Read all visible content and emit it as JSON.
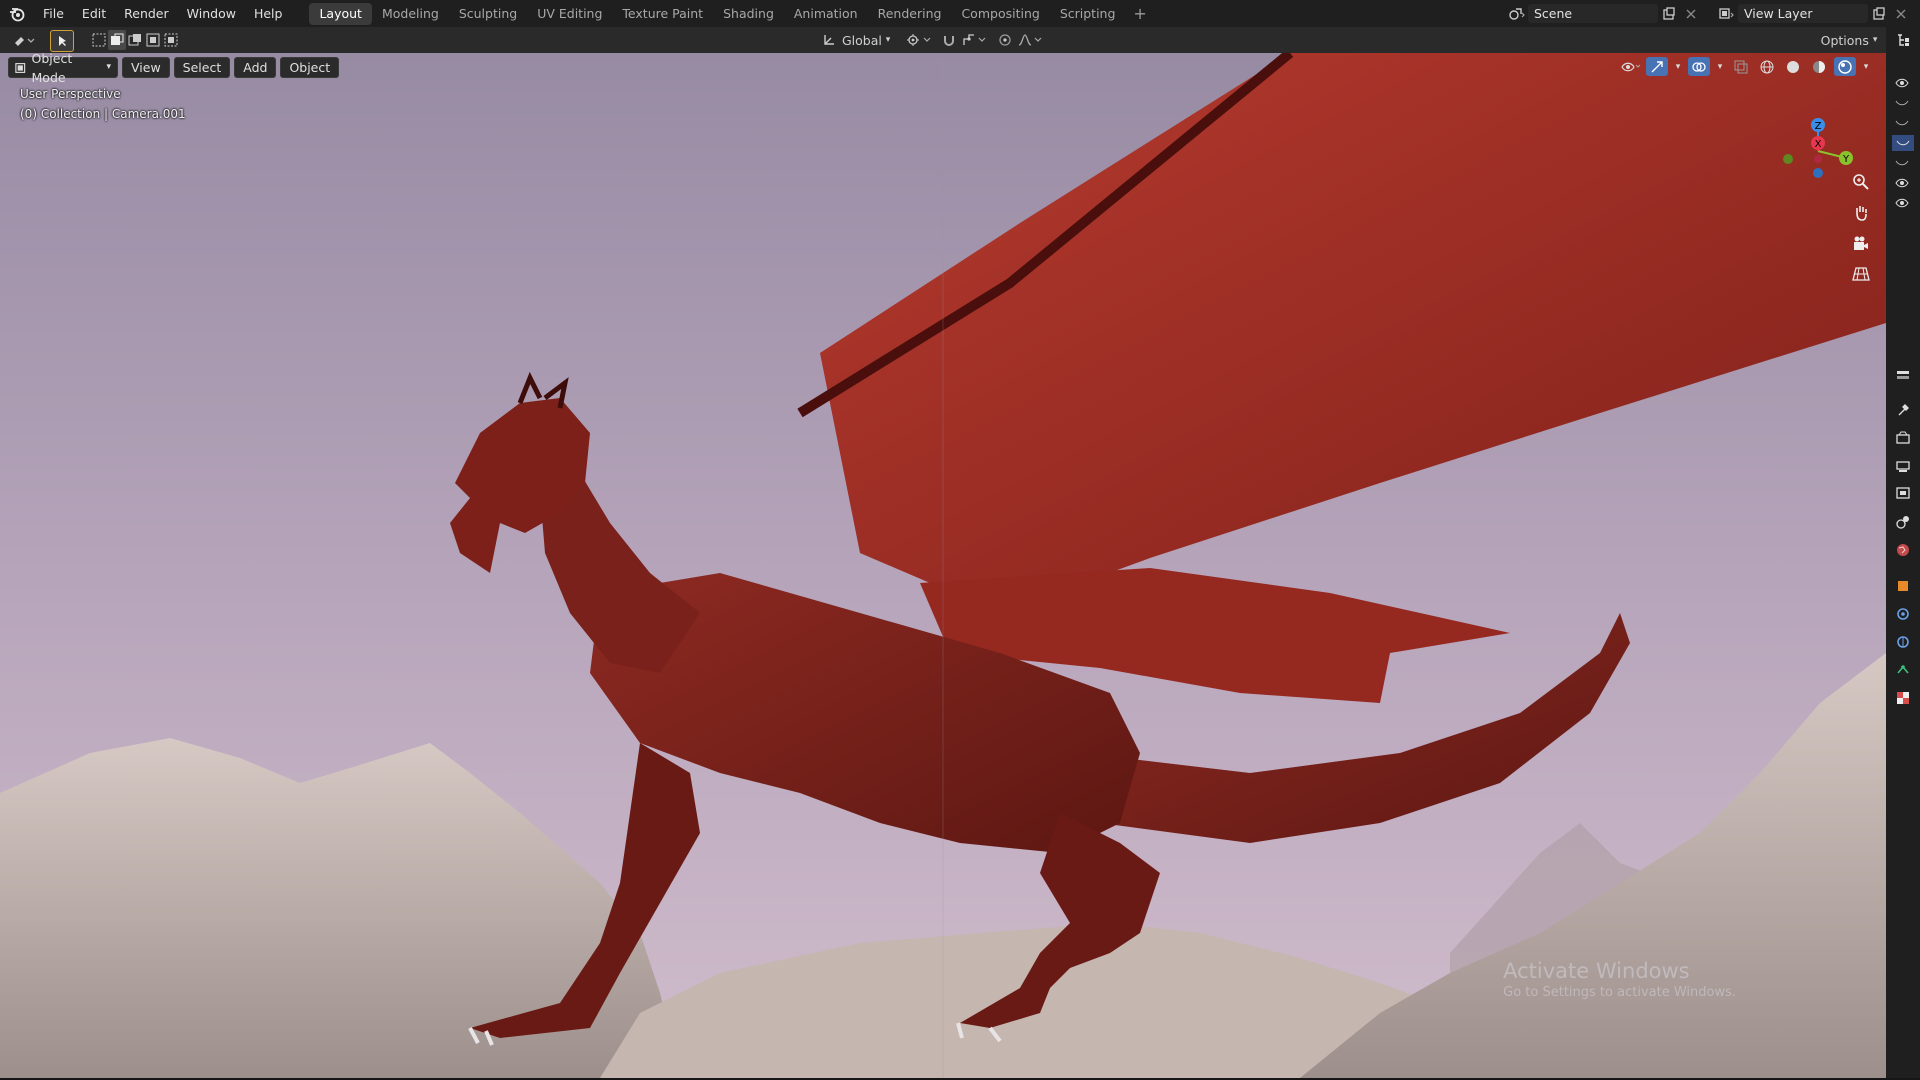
{
  "menubar": {
    "items": [
      "File",
      "Edit",
      "Render",
      "Window",
      "Help"
    ]
  },
  "workspaces": {
    "tabs": [
      "Layout",
      "Modeling",
      "Sculpting",
      "UV Editing",
      "Texture Paint",
      "Shading",
      "Animation",
      "Rendering",
      "Compositing",
      "Scripting"
    ],
    "active": "Layout",
    "add_symbol": "+"
  },
  "scene": {
    "name": "Scene"
  },
  "view_layer": {
    "name": "View Layer"
  },
  "toolbar": {
    "transform_orientation": "Global",
    "options_label": "Options"
  },
  "viewport": {
    "mode": "Object Mode",
    "menus": [
      "View",
      "Select",
      "Add",
      "Object"
    ],
    "perspective_text": "User Perspective",
    "collection_text": "(0) Collection | Camera.001"
  },
  "gizmo": {
    "axes": [
      "X",
      "Y",
      "Z"
    ],
    "colors": {
      "x": "#e8364f",
      "y": "#89c22c",
      "z": "#3a8de8"
    }
  },
  "watermark": {
    "line1": "Activate Windows",
    "line2": "Go to Settings to activate Windows."
  },
  "colors": {
    "sky_top": "#998aa0",
    "sky_bottom": "#c9b4c6",
    "dragon": "#7d1f1a",
    "wing": "#a3302a",
    "mountain": "#b9aaa4",
    "active_tab_bg": "#3b3b3b"
  }
}
